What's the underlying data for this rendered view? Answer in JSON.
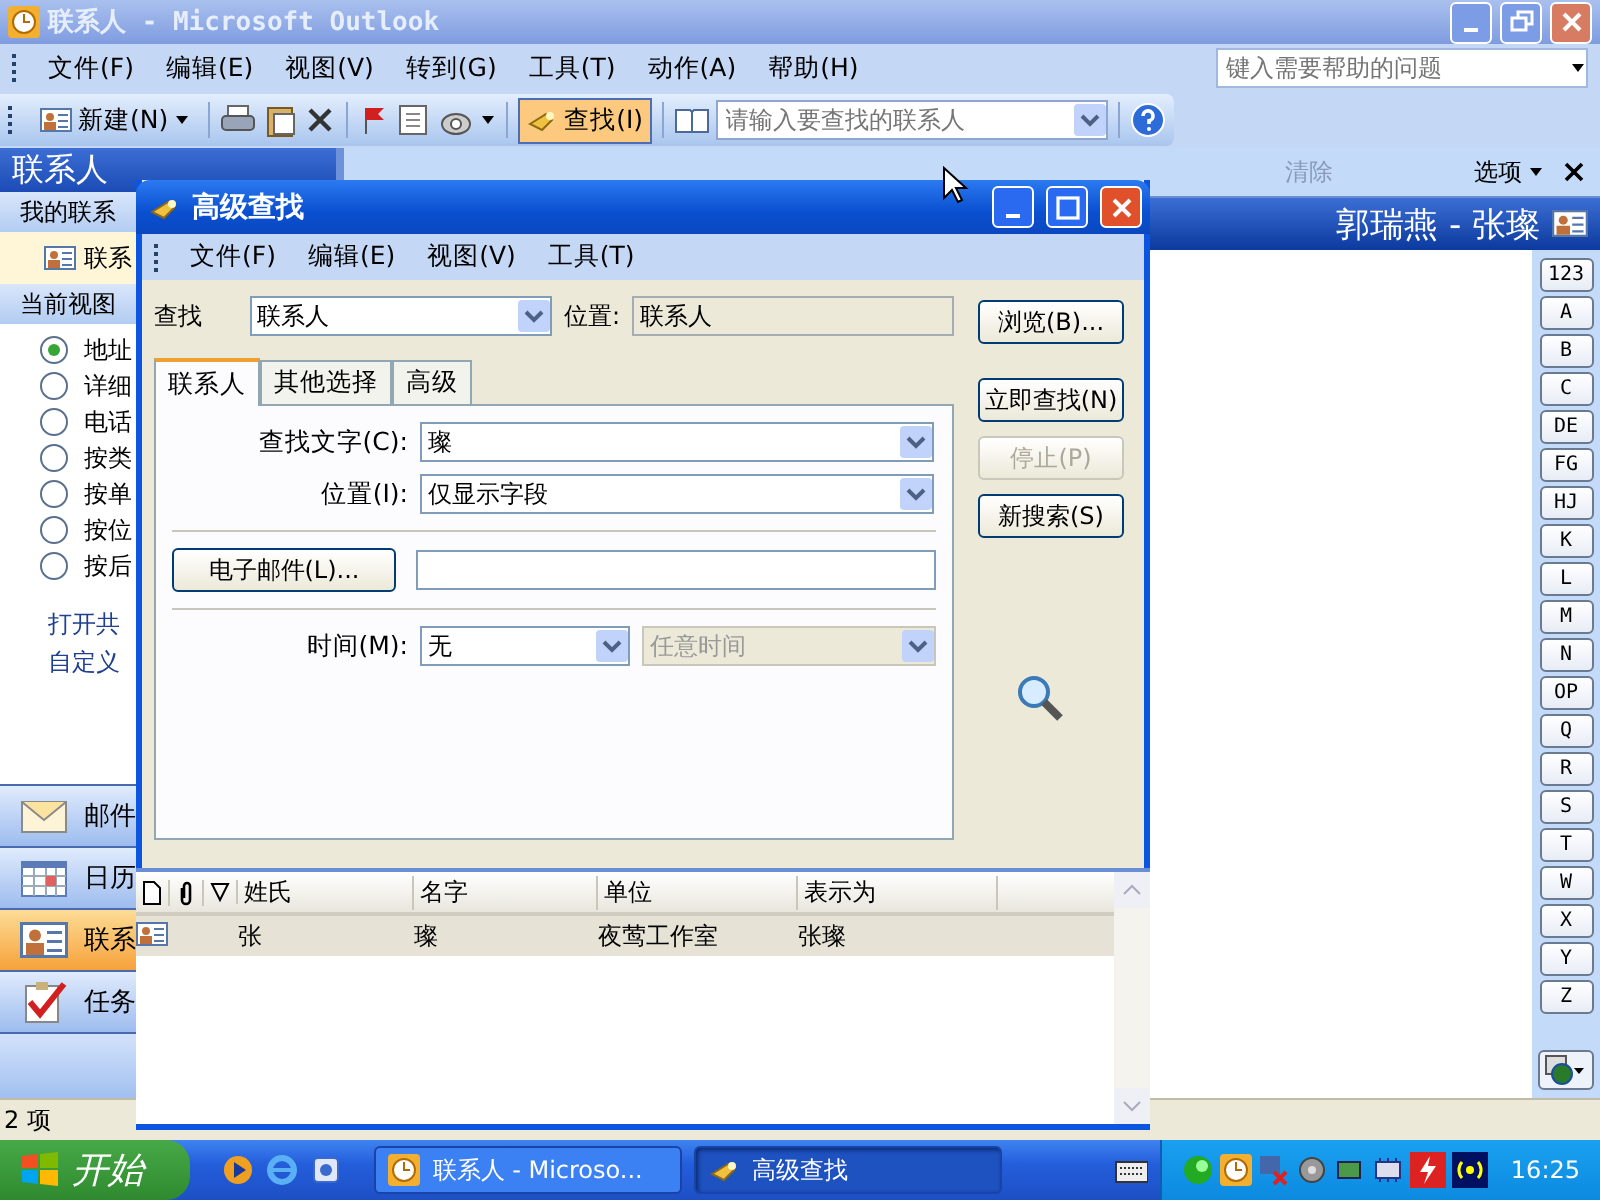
{
  "window": {
    "title": "联系人 - Microsoft Outlook"
  },
  "menu": [
    "文件(F)",
    "编辑(E)",
    "视图(V)",
    "转到(G)",
    "工具(T)",
    "动作(A)",
    "帮助(H)"
  ],
  "help_box": {
    "placeholder": "键入需要帮助的问题"
  },
  "toolbar": {
    "new_button": "新建(N)",
    "find_button": {
      "label": "查找(I)",
      "selected": true
    },
    "contact_search": {
      "placeholder": "请输入要查找的联系人"
    }
  },
  "find_bar": {
    "clear": "清除",
    "options": "选项"
  },
  "nav": {
    "title": "联系人",
    "my_contacts": "我的联系",
    "contact_folder": "联系",
    "current_view": "当前视图",
    "views": [
      {
        "label": "地址",
        "selected": true
      },
      {
        "label": "详细",
        "selected": false
      },
      {
        "label": "电话",
        "selected": false
      },
      {
        "label": "按类",
        "selected": false
      },
      {
        "label": "按单",
        "selected": false
      },
      {
        "label": "按位",
        "selected": false
      },
      {
        "label": "按后",
        "selected": false
      }
    ],
    "links": [
      "打开共",
      "自定义"
    ],
    "buttons": [
      {
        "label": "邮件",
        "kind": "mail",
        "selected": false
      },
      {
        "label": "日历",
        "kind": "calendar",
        "selected": false
      },
      {
        "label": "联系",
        "kind": "contacts",
        "selected": true
      },
      {
        "label": "任务",
        "kind": "tasks",
        "selected": false
      }
    ]
  },
  "contact_header": "郭瑞燕 - 张璨",
  "alphabet": [
    "123",
    "A",
    "B",
    "C",
    "DE",
    "FG",
    "HJ",
    "K",
    "L",
    "M",
    "N",
    "OP",
    "Q",
    "R",
    "S",
    "T",
    "W",
    "X",
    "Y",
    "Z"
  ],
  "status_bar": "2 项",
  "dialog": {
    "title": "高级查找",
    "menu": [
      "文件(F)",
      "编辑(E)",
      "视图(V)",
      "工具(T)"
    ],
    "look_for_label": "查找",
    "look_for": "联系人",
    "in_label": "位置:",
    "in": "联系人",
    "tabs": [
      {
        "label": "联系人",
        "selected": true
      },
      {
        "label": "其他选择",
        "selected": false
      },
      {
        "label": "高级",
        "selected": false
      }
    ],
    "fields": [
      {
        "label": "查找文字(C):",
        "value": "璨"
      },
      {
        "label": "位置(I):",
        "value": "仅显示字段"
      }
    ],
    "email_button": "电子邮件(L)...",
    "time_label": "时间(M):",
    "time": "无",
    "time_range": {
      "value": "任意时间",
      "disabled": true
    },
    "buttons": [
      {
        "label": "浏览(B)...",
        "disabled": false
      },
      {
        "label": "立即查找(N)",
        "disabled": false
      },
      {
        "label": "停止(P)",
        "disabled": true
      },
      {
        "label": "新搜索(S)",
        "disabled": false
      }
    ],
    "results": {
      "columns": [
        "姓氏",
        "名字",
        "单位",
        "表示为"
      ],
      "rows": [
        {
          "cells": [
            "张",
            "璨",
            "夜莺工作室",
            "张璨"
          ],
          "selected": true
        }
      ]
    }
  },
  "taskbar": {
    "start": "开始",
    "tasks": [
      {
        "label": "联系人 - Microso...",
        "kind": "outlook",
        "selected": false
      },
      {
        "label": "高级查找",
        "kind": "find",
        "selected": true
      }
    ],
    "clock": "16:25"
  }
}
